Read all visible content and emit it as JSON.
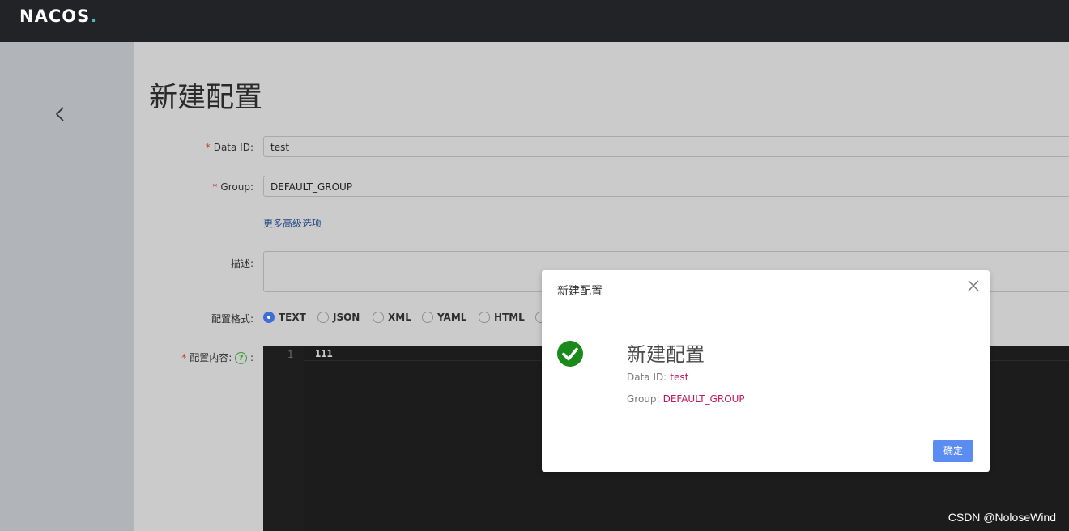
{
  "header": {
    "logo_text": "NACOS",
    "logo_dot": "."
  },
  "sidebar": {
    "back_icon": "chevron-left-icon"
  },
  "page": {
    "title": "新建配置"
  },
  "form": {
    "data_id": {
      "required": "*",
      "label": "Data ID:",
      "value": "test"
    },
    "group": {
      "required": "*",
      "label": "Group:",
      "value": "DEFAULT_GROUP"
    },
    "advanced_link": "更多高级选项",
    "description": {
      "label": "描述:",
      "value": ""
    },
    "format": {
      "label": "配置格式:",
      "options": [
        "TEXT",
        "JSON",
        "XML",
        "YAML",
        "HTML"
      ],
      "selected": "TEXT"
    },
    "content": {
      "required": "*",
      "label": "配置内容:",
      "help": "?",
      "colon": ":"
    }
  },
  "editor": {
    "line_number": "1",
    "line_text": "111"
  },
  "dialog": {
    "title": "新建配置",
    "heading": "新建配置",
    "data_id_label": "Data ID:",
    "data_id_value": "test",
    "group_label": "Group:",
    "group_value": "DEFAULT_GROUP",
    "ok_label": "确定",
    "success_color": "#1a8a1a"
  },
  "watermark": "CSDN @NoloseWind"
}
